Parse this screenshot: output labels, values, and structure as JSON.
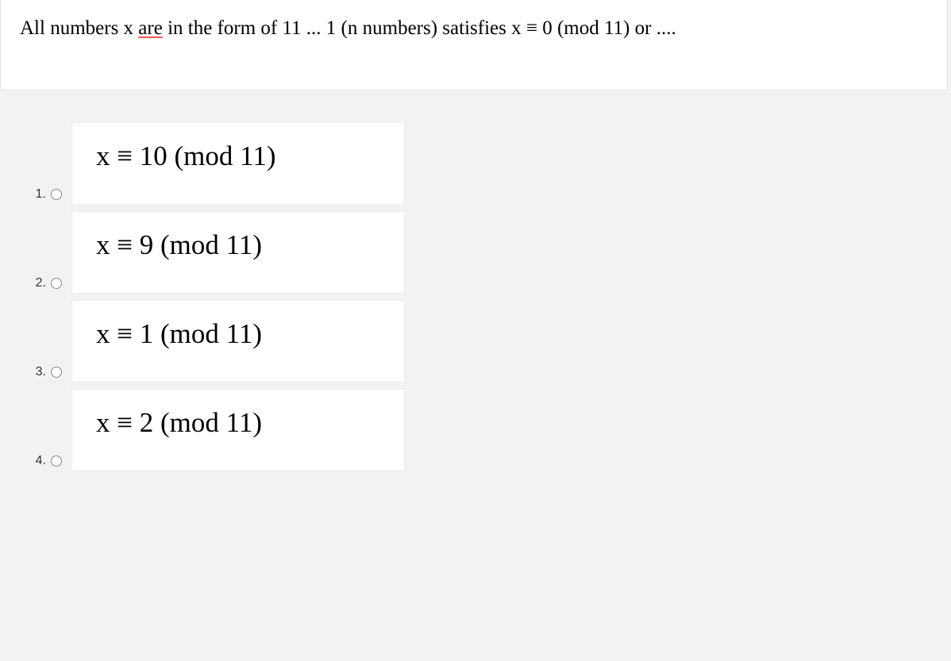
{
  "question": {
    "prefix": "All numbers x ",
    "underlined": "are",
    "suffix": " in the form of 11 ... 1 (n numbers) satisfies x ≡ 0 (mod 11) or ...."
  },
  "options": [
    {
      "number": "1.",
      "text": "x ≡ 10 (mod 11)"
    },
    {
      "number": "2.",
      "text": "x ≡ 9 (mod 11)"
    },
    {
      "number": "3.",
      "text": "x ≡ 1 (mod 11)"
    },
    {
      "number": "4.",
      "text": "x ≡ 2 (mod 11)"
    }
  ]
}
